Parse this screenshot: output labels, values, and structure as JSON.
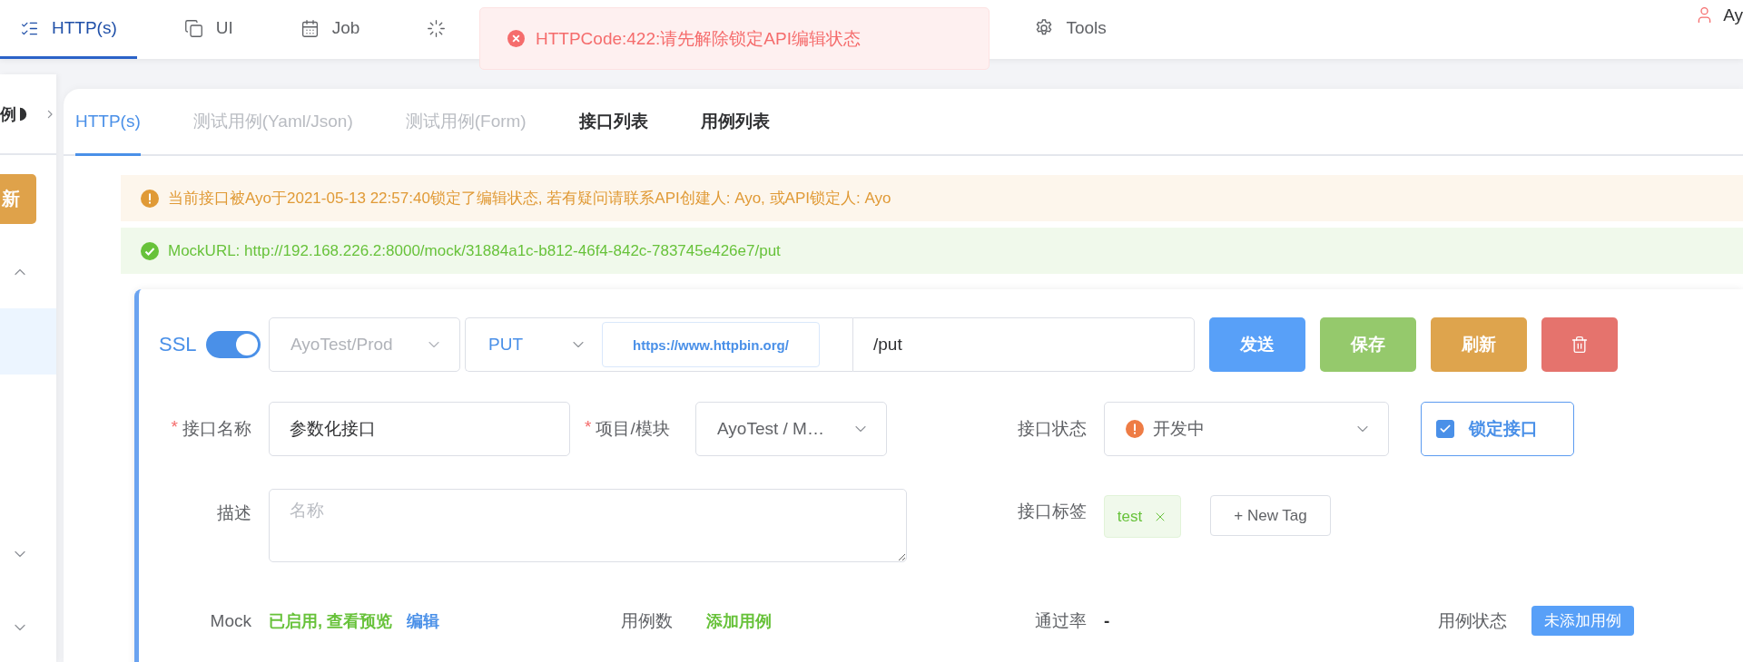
{
  "top_nav": {
    "items": [
      {
        "kind": "checklist",
        "label": "HTTP(s)",
        "selected": true
      },
      {
        "kind": "copy",
        "label": "UI",
        "selected": false
      },
      {
        "kind": "calendar",
        "label": "Job",
        "selected": false
      },
      {
        "kind": "loader",
        "selected": false
      },
      {
        "kind": "gear",
        "label": "Tools",
        "selected": false
      }
    ],
    "user": "Ay"
  },
  "toast": {
    "message": "HTTPCode:422:请先解除锁定API编辑状态"
  },
  "sidebar": {
    "crumb": "例",
    "button": "新",
    "groups": [
      {
        "expanded": true,
        "items": [
          {
            "selected": true
          }
        ]
      },
      {
        "expanded": false
      },
      {
        "expanded": false
      }
    ]
  },
  "tabs": [
    {
      "label": "HTTP(s)",
      "selected": true,
      "disabled": false
    },
    {
      "label": "测试用例(Yaml/Json)",
      "selected": false,
      "disabled": true
    },
    {
      "label": "测试用例(Form)",
      "selected": false,
      "disabled": true
    },
    {
      "label": "接口列表",
      "selected": false,
      "disabled": false
    },
    {
      "label": "用例列表",
      "selected": false,
      "disabled": false
    }
  ],
  "alerts": [
    {
      "kind": "warning",
      "text": "当前接口被Ayo于2021-05-13 22:57:40锁定了编辑状态, 若有疑问请联系API创建人: Ayo, 或API锁定人: Ayo"
    },
    {
      "kind": "success",
      "text": "MockURL: http://192.168.226.2:8000/mock/31884a1c-b812-46f4-842c-783745e426e7/put"
    }
  ],
  "request": {
    "ssl": {
      "label": "SSL",
      "on": true
    },
    "environment": {
      "placeholder": "AyoTest/Prod"
    },
    "method": "PUT",
    "base_url": "https://www.httpbin.org/",
    "path": "/put",
    "buttons": [
      {
        "kind": "send",
        "label": "发送"
      },
      {
        "kind": "save",
        "label": "保存"
      },
      {
        "kind": "refresh",
        "label": "刷新"
      },
      {
        "kind": "delete"
      }
    ]
  },
  "form": {
    "name": {
      "required_mark": "*",
      "label": "接口名称",
      "value": "参数化接口"
    },
    "project": {
      "required_mark": "*",
      "label": "项目/模块",
      "value": "AyoTest / M…"
    },
    "status": {
      "label": "接口状态",
      "value": "开发中"
    },
    "lock": {
      "label": "锁定接口",
      "checked": true
    },
    "description": {
      "label": "描述",
      "placeholder": "名称"
    },
    "tags": {
      "label": "接口标签",
      "items": [
        "test"
      ],
      "new_tag": "+ New Tag"
    }
  },
  "stats": {
    "mock": {
      "label": "Mock",
      "status": "已启用, 查看预览",
      "edit": "编辑"
    },
    "case_count": {
      "label": "用例数",
      "action": "添加用例"
    },
    "pass_rate": {
      "label": "通过率",
      "value": "-"
    },
    "case_status": {
      "label": "用例状态",
      "badge": "未添加用例"
    }
  }
}
